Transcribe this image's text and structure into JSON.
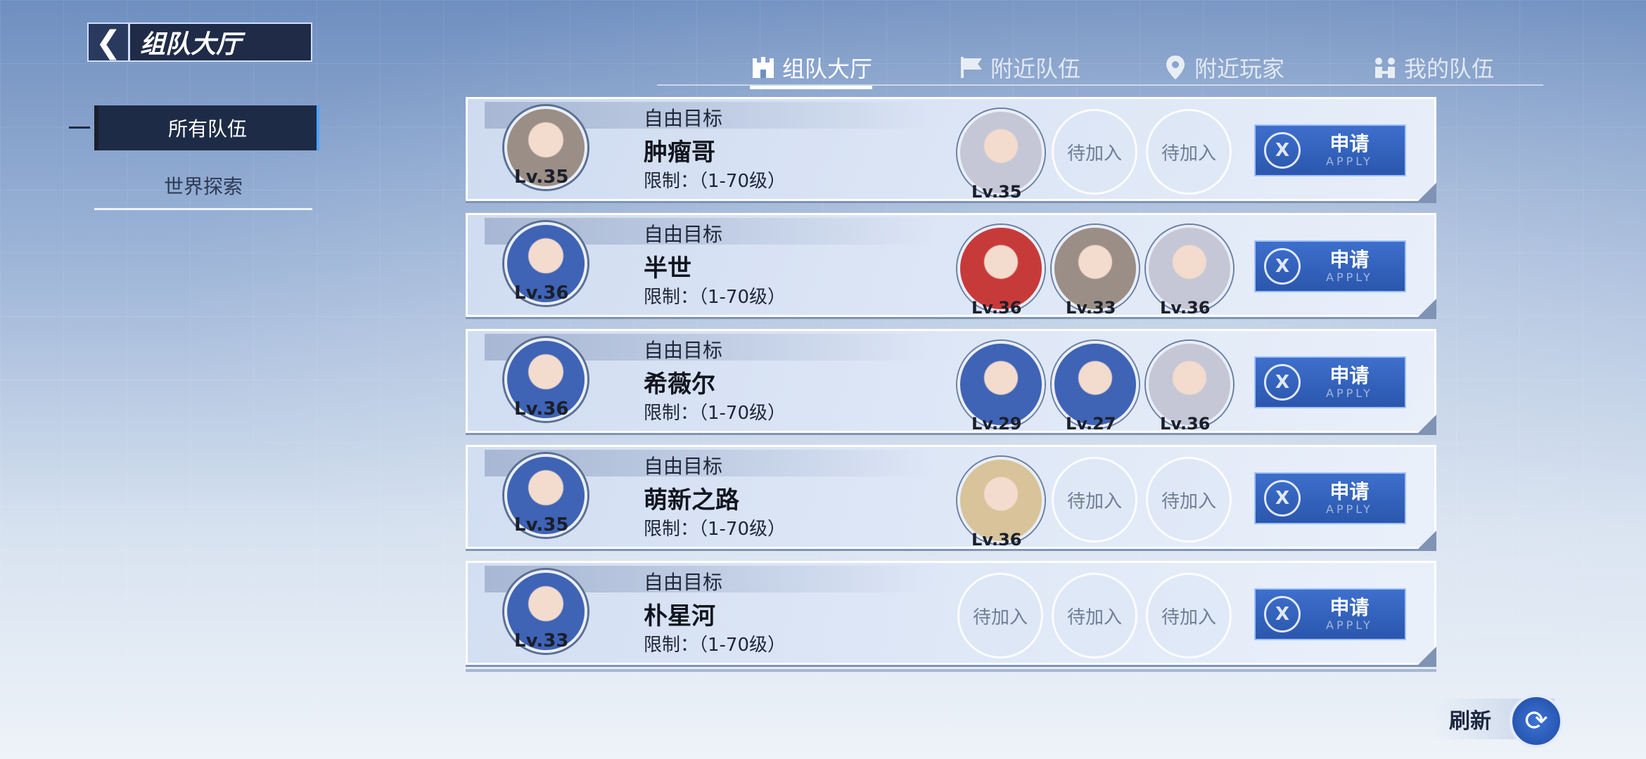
{
  "header": {
    "title": "组队大厅"
  },
  "sidebar": {
    "items": [
      {
        "label": "所有队伍"
      },
      {
        "label": "世界探索"
      }
    ]
  },
  "tabs": [
    {
      "label": "组队大厅",
      "icon": "castle-icon"
    },
    {
      "label": "附近队伍",
      "icon": "flag-icon"
    },
    {
      "label": "附近玩家",
      "icon": "location-pin-icon"
    },
    {
      "label": "我的队伍",
      "icon": "team-icon"
    }
  ],
  "teams": [
    {
      "goal": "自由目标",
      "name": "肿瘤哥",
      "limit": "限制：（1-70级）",
      "captain": {
        "level": "Lv.35",
        "color": "#9a8e86"
      },
      "slots": [
        {
          "level": "Lv.35",
          "color": "#c6c7d6"
        },
        {
          "empty": "待加入"
        },
        {
          "empty": "待加入"
        }
      ],
      "apply": {
        "label": "申请",
        "sub": "APPLY"
      }
    },
    {
      "goal": "自由目标",
      "name": "半世",
      "limit": "限制：（1-70级）",
      "captain": {
        "level": "Lv.36",
        "color": "#3f63b5"
      },
      "slots": [
        {
          "level": "Lv.36",
          "color": "#c73a3a"
        },
        {
          "level": "Lv.33",
          "color": "#9a8e86"
        },
        {
          "level": "Lv.36",
          "color": "#c6c7d6"
        }
      ],
      "apply": {
        "label": "申请",
        "sub": "APPLY"
      }
    },
    {
      "goal": "自由目标",
      "name": "希薇尔",
      "limit": "限制：（1-70级）",
      "captain": {
        "level": "Lv.36",
        "color": "#3f63b5"
      },
      "slots": [
        {
          "level": "Lv.29",
          "color": "#3f63b5"
        },
        {
          "level": "Lv.27",
          "color": "#3f63b5"
        },
        {
          "level": "Lv.36",
          "color": "#c6c7d6"
        }
      ],
      "apply": {
        "label": "申请",
        "sub": "APPLY"
      }
    },
    {
      "goal": "自由目标",
      "name": "萌新之路",
      "limit": "限制：（1-70级）",
      "captain": {
        "level": "Lv.35",
        "color": "#3f63b5"
      },
      "slots": [
        {
          "level": "Lv.36",
          "color": "#d8c39a"
        },
        {
          "empty": "待加入"
        },
        {
          "empty": "待加入"
        }
      ],
      "apply": {
        "label": "申请",
        "sub": "APPLY"
      }
    },
    {
      "goal": "自由目标",
      "name": "朴星河",
      "limit": "限制：（1-70级）",
      "captain": {
        "level": "Lv.33",
        "color": "#3f63b5"
      },
      "slots": [
        {
          "empty": "待加入"
        },
        {
          "empty": "待加入"
        },
        {
          "empty": "待加入"
        }
      ],
      "apply": {
        "label": "申请",
        "sub": "APPLY"
      }
    }
  ],
  "refresh": {
    "label": "刷新"
  }
}
